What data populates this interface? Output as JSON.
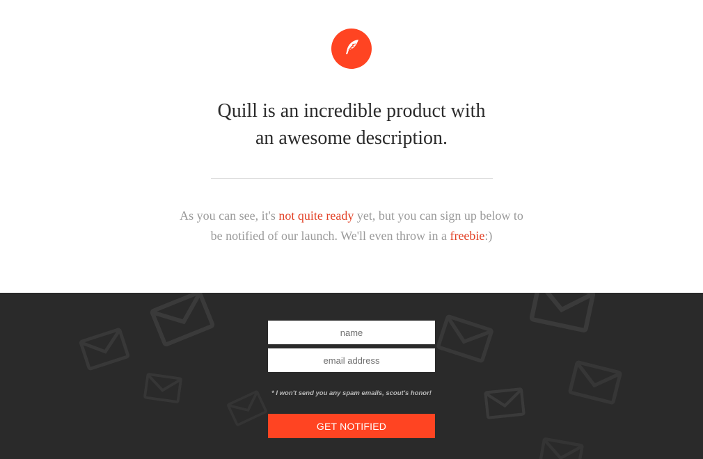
{
  "brand": {
    "logo_icon": "feather-icon",
    "accent_color": "#ff4422"
  },
  "headline": {
    "line1": "Quill is an incredible product with",
    "line2": "an awesome description."
  },
  "blurb": {
    "part1": "As you can see, it's ",
    "link1": "not quite ready",
    "part2": " yet, but you can sign up below to be notified of our launch. We'll even throw in a ",
    "link2": "freebie",
    "part3": ":)"
  },
  "signup": {
    "name_placeholder": "name",
    "email_placeholder": "email address",
    "disclaimer": "* I won't send you any spam emails, scout's honor!",
    "button_label": "GET NOTIFIED",
    "background_icon": "envelope-icon",
    "background_color": "#2a2a2a"
  }
}
